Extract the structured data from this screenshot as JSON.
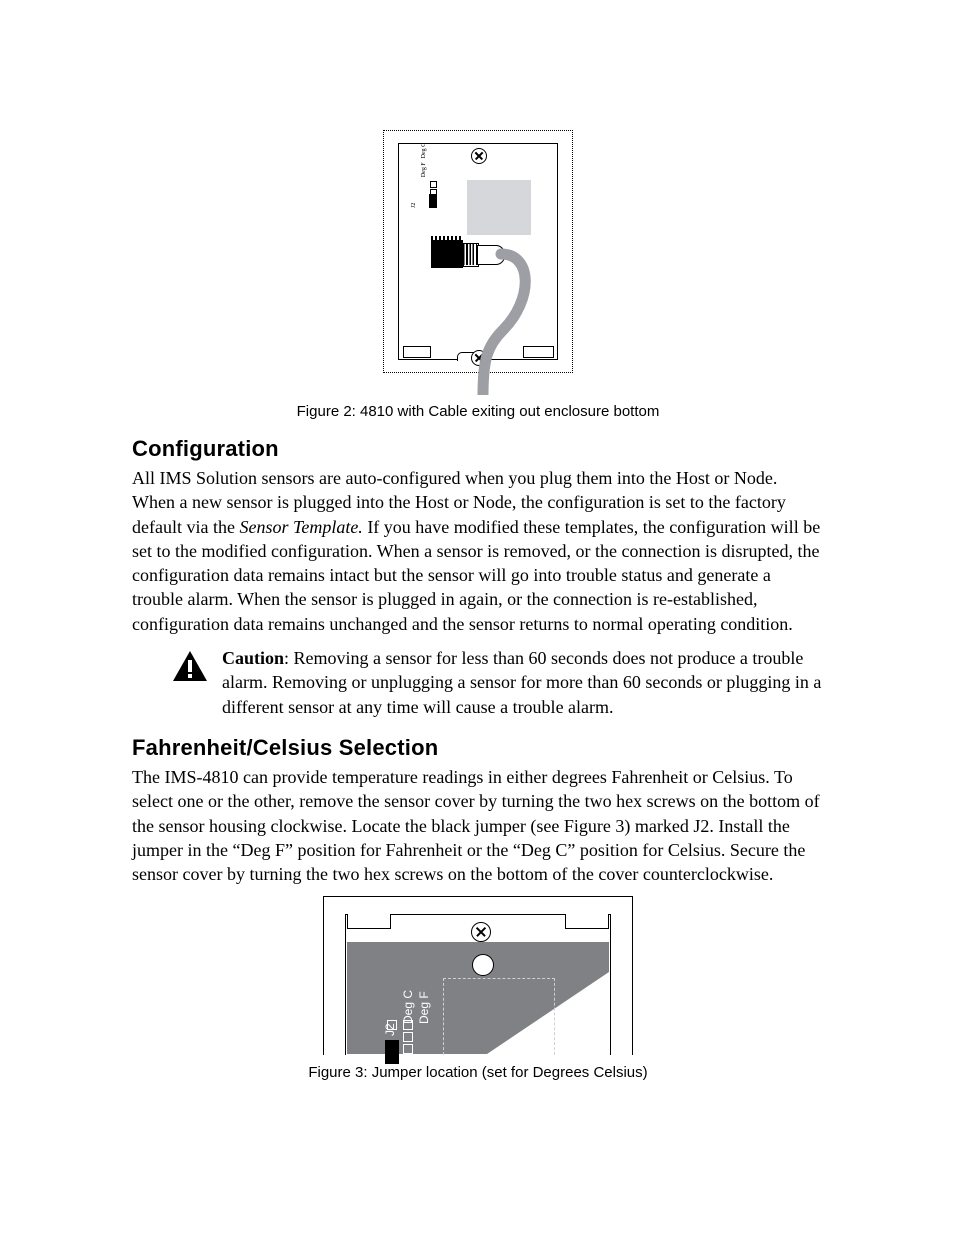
{
  "figure2": {
    "caption": "Figure 2: 4810 with Cable exiting out enclosure bottom",
    "jumper": {
      "j2": "J2",
      "degC": "Deg C",
      "degF": "Deg F"
    }
  },
  "section1": {
    "heading": "Configuration",
    "body_part1": "All IMS Solution sensors are auto-configured when you plug them into the Host or Node.  When a new sensor is plugged into the Host or Node, the configuration is set to the factory default via the ",
    "body_italic": "Sensor Template.",
    "body_part2": "  If you have modified these templates, the configuration will be set to the modified configuration.  When a sensor is removed, or the connection is disrupted, the configuration data remains intact but the sensor will go into trouble status and generate a trouble alarm.  When the sensor is plugged in again, or the connection is re-established, configuration data remains unchanged and the sensor returns to normal operating condition."
  },
  "caution": {
    "label": "Caution",
    "text": ": Removing a sensor for less than 60 seconds does not produce a trouble alarm. Removing or unplugging a sensor for more than 60 seconds or plugging in a different sensor at any time will cause a trouble alarm."
  },
  "section2": {
    "heading": "Fahrenheit/Celsius Selection",
    "body": "The IMS-4810 can provide temperature readings in either degrees Fahrenheit or Celsius. To select one or the other, remove the sensor cover by turning the two hex screws on the bottom of the sensor housing clockwise. Locate the black jumper (see Figure 3) marked J2. Install the jumper in the “Deg F” position for Fahrenheit or the “Deg C” position for Celsius. Secure the sensor cover by turning the two hex screws on the bottom of the cover counterclockwise."
  },
  "figure3": {
    "caption": "Figure 3: Jumper location (set for Degrees Celsius)",
    "labels": {
      "j2": "J2",
      "degC": "Deg C",
      "degF": "Deg F"
    }
  }
}
